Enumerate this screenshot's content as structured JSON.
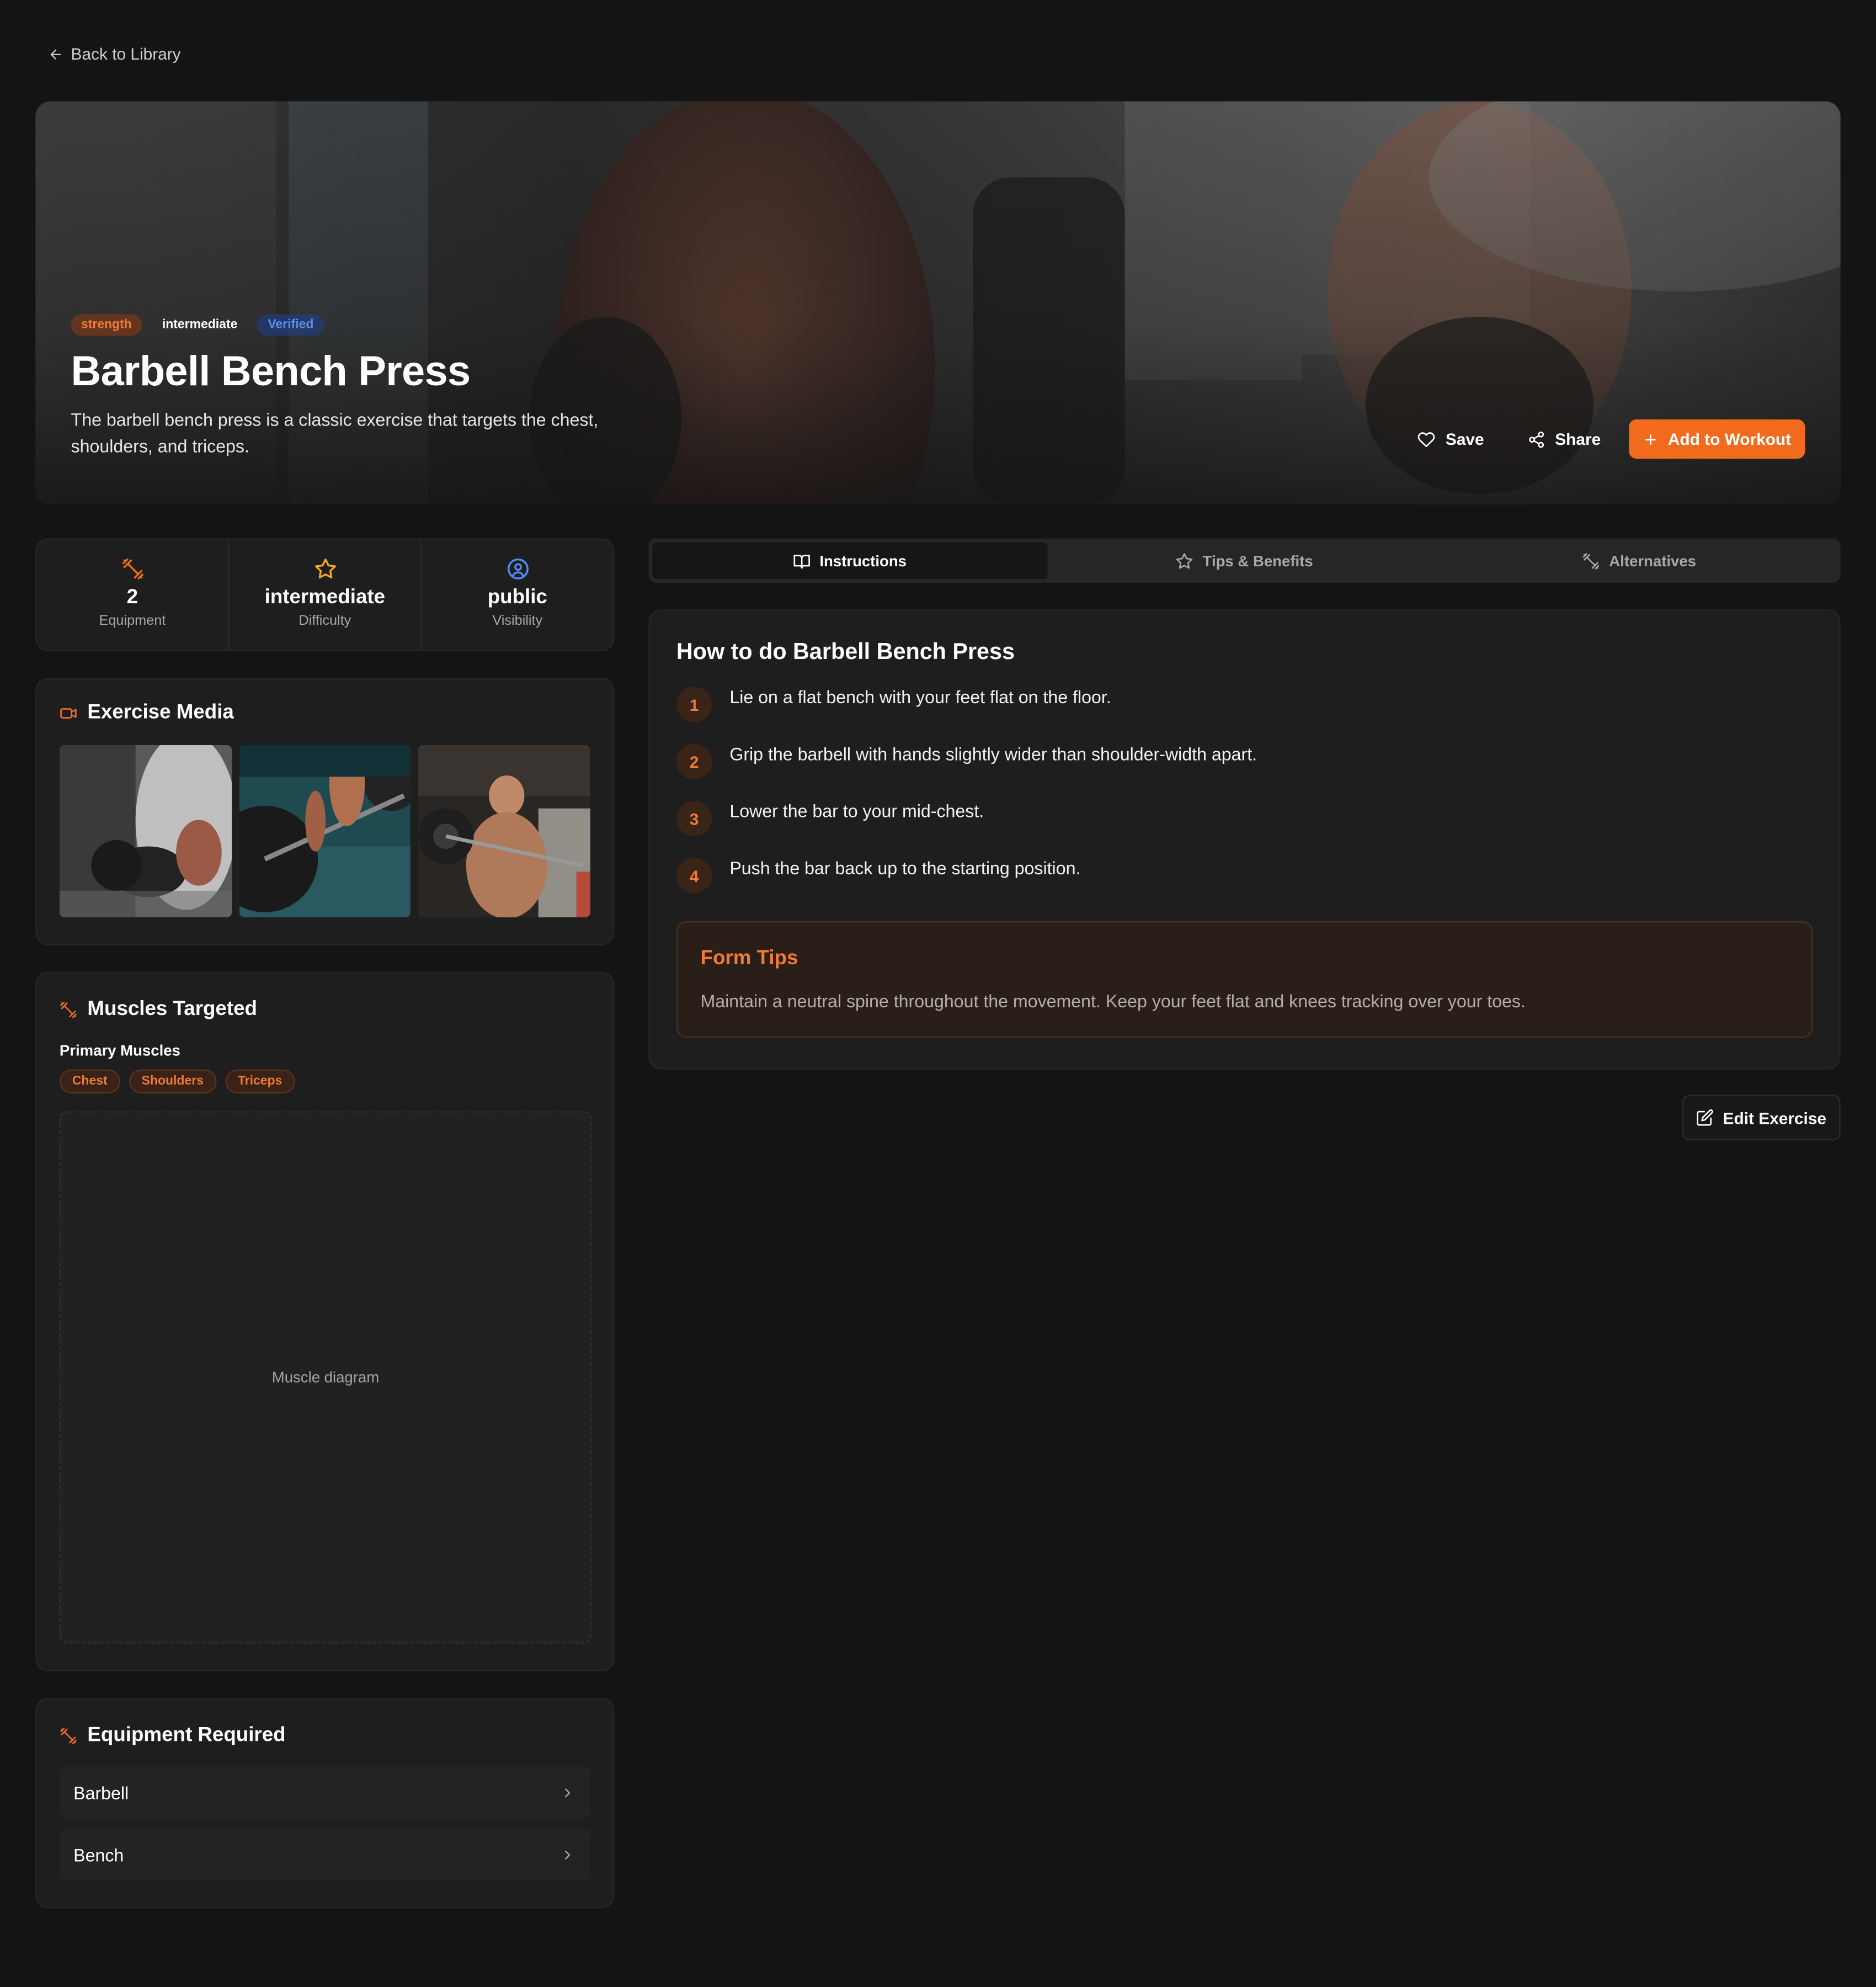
{
  "nav": {
    "back_label": "Back to Library"
  },
  "hero": {
    "tags": {
      "category": "strength",
      "difficulty": "intermediate",
      "verified": "Verified"
    },
    "title": "Barbell Bench Press",
    "description": "The barbell bench press is a classic exercise that targets the chest, shoulders, and triceps.",
    "actions": {
      "save": "Save",
      "share": "Share",
      "add": "Add to Workout"
    }
  },
  "stats": [
    {
      "value": "2",
      "label": "Equipment",
      "icon": "dumbbell-icon"
    },
    {
      "value": "intermediate",
      "label": "Difficulty",
      "icon": "star-icon"
    },
    {
      "value": "public",
      "label": "Visibility",
      "icon": "user-circle-icon"
    }
  ],
  "media": {
    "title": "Exercise Media",
    "icon": "video-icon"
  },
  "muscles": {
    "title": "Muscles Targeted",
    "primary_label": "Primary Muscles",
    "primary": [
      "Chest",
      "Shoulders",
      "Triceps"
    ],
    "diagram_placeholder": "Muscle diagram"
  },
  "equipment": {
    "title": "Equipment Required",
    "items": [
      "Barbell",
      "Bench"
    ]
  },
  "tabs": [
    {
      "label": "Instructions",
      "icon": "book-open-icon",
      "active": true
    },
    {
      "label": "Tips & Benefits",
      "icon": "star-icon",
      "active": false
    },
    {
      "label": "Alternatives",
      "icon": "dumbbell-icon",
      "active": false
    }
  ],
  "instructions": {
    "title": "How to do Barbell Bench Press",
    "steps": [
      {
        "num": "1",
        "text": "Lie on a flat bench with your feet flat on the floor."
      },
      {
        "num": "2",
        "text": "Grip the barbell with hands slightly wider than shoulder-width apart."
      },
      {
        "num": "3",
        "text": "Lower the bar to your mid-chest."
      },
      {
        "num": "4",
        "text": "Push the bar back up to the starting position."
      }
    ],
    "form_tips": {
      "title": "Form Tips",
      "text": "Maintain a neutral spine throughout the movement. Keep your feet flat and knees tracking over your toes."
    }
  },
  "edit": {
    "label": "Edit Exercise"
  },
  "colors": {
    "accent": "#f26b1d",
    "background": "#141414",
    "card": "#1e1e1e",
    "verified": "#5a8ef0"
  }
}
